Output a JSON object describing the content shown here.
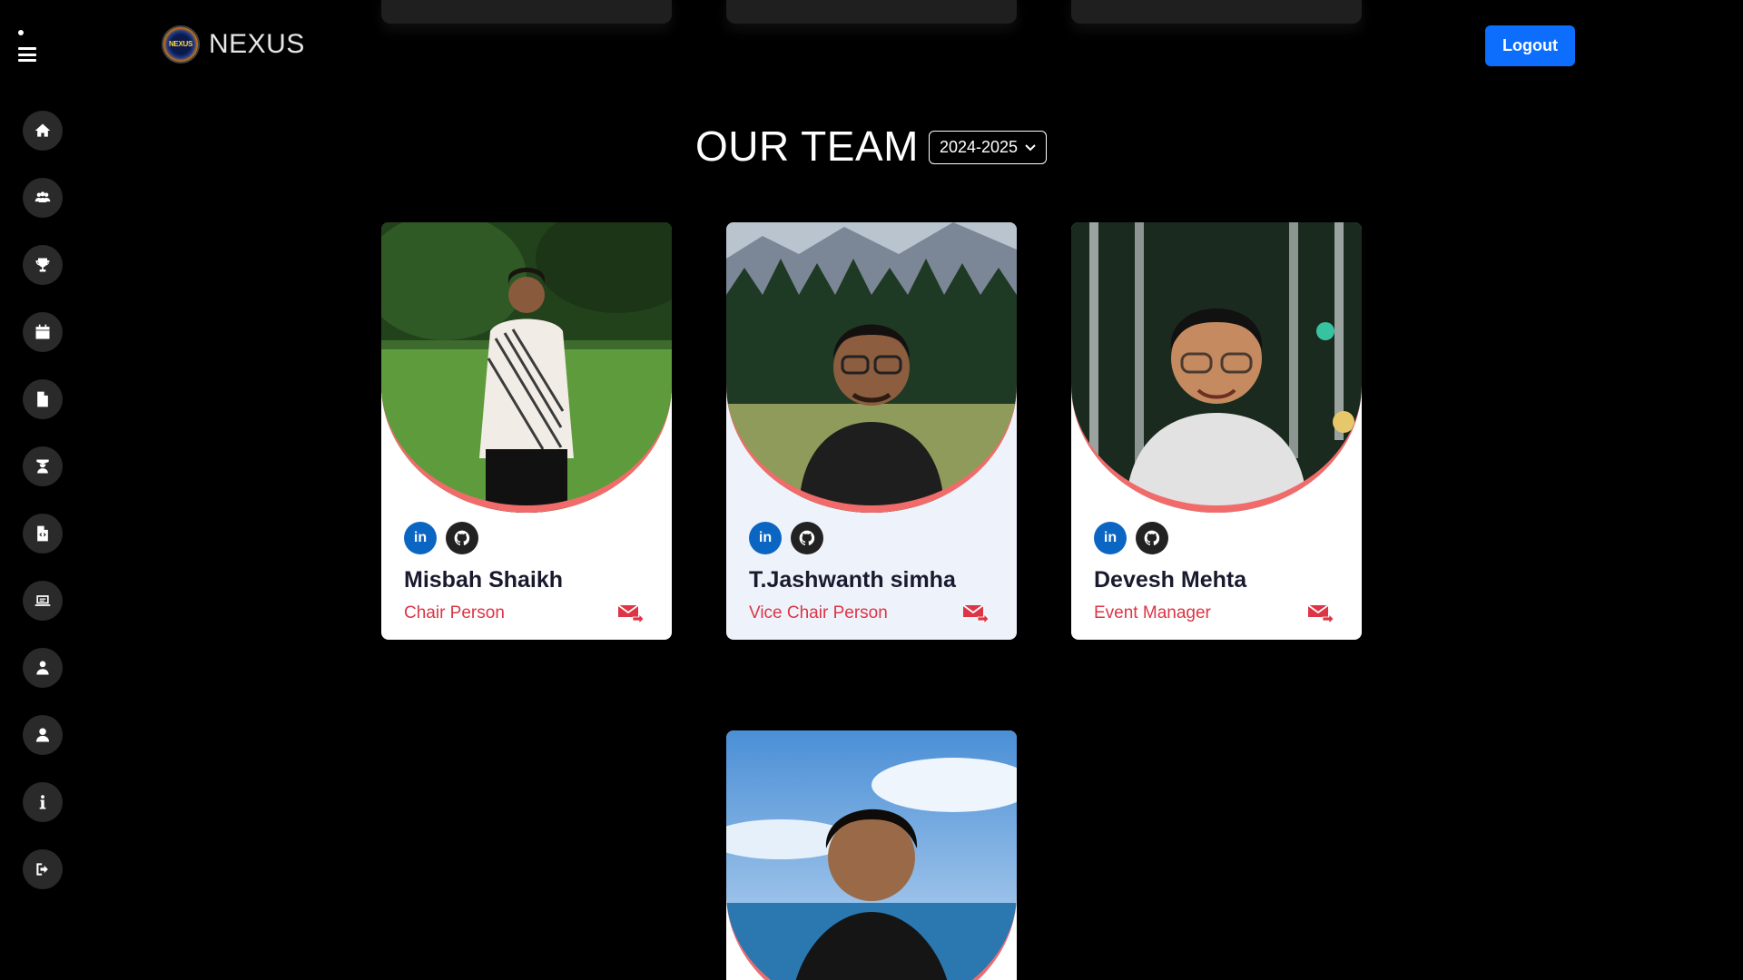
{
  "header": {
    "brand_logo_text": "NEXUS",
    "brand_name": "NEXUS",
    "logout_label": "Logout"
  },
  "sidebar": {
    "items": [
      {
        "icon": "home-icon"
      },
      {
        "icon": "users-icon"
      },
      {
        "icon": "trophy-icon"
      },
      {
        "icon": "calendar-icon"
      },
      {
        "icon": "document-icon"
      },
      {
        "icon": "graduate-icon"
      },
      {
        "icon": "code-file-icon"
      },
      {
        "icon": "laptop-icon"
      },
      {
        "icon": "admin-user-icon"
      },
      {
        "icon": "user-icon"
      },
      {
        "icon": "info-icon"
      },
      {
        "icon": "sign-out-icon"
      }
    ]
  },
  "main": {
    "title": "OUR TEAM",
    "year_selected": "2024-2025",
    "members": [
      {
        "name": "Misbah Shaikh",
        "role": "Chair Person",
        "linkedin_label": "in"
      },
      {
        "name": "T.Jashwanth simha",
        "role": "Vice Chair Person",
        "linkedin_label": "in"
      },
      {
        "name": "Devesh Mehta",
        "role": "Event Manager",
        "linkedin_label": "in"
      }
    ]
  },
  "colors": {
    "accent": "#0d6efd",
    "role_text": "#dc3545",
    "photo_border": "#f26b6b",
    "linkedin": "#0a66c2"
  }
}
